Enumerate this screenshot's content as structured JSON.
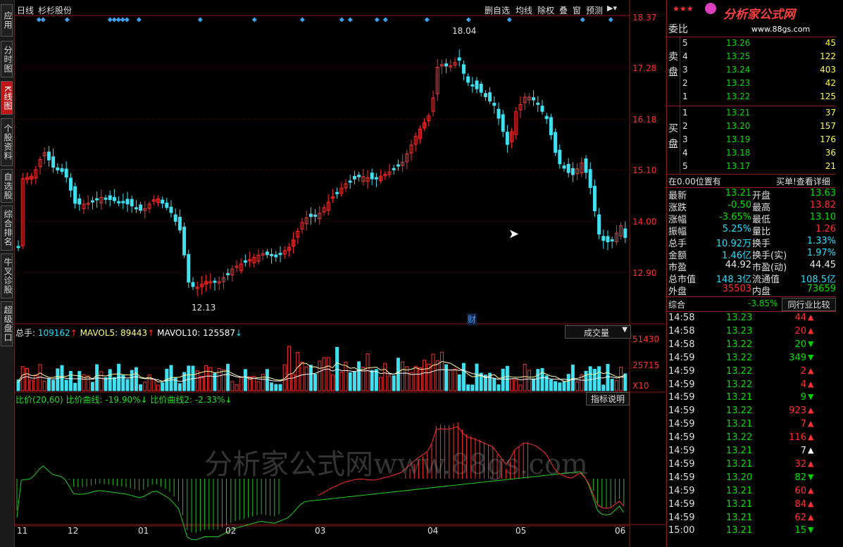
{
  "left_tabs": [
    "应用",
    "分时图",
    "K线图",
    "个股资料",
    "自选股",
    "综合排名",
    "牛叉诊股",
    "超级盘口"
  ],
  "header": {
    "period": "日线",
    "stock_name": "杉杉股份",
    "buttons": [
      "删自选",
      "均线",
      "除权",
      "叠",
      "窗",
      "预测"
    ],
    "logo_text": "分析家公式网",
    "logo_url": "www.88gs.com",
    "stars": "★★★"
  },
  "price_axis": [
    "18.37",
    "17.28",
    "16.18",
    "15.10",
    "14.00",
    "12.90"
  ],
  "annotations": {
    "high_label": "18.04",
    "low_label": "12.13",
    "cai_marker": "财"
  },
  "volume_panel": {
    "total_label": "总手:",
    "total_value": "109162",
    "mavol5_label": "MAVOL5:",
    "mavol5_value": "89443",
    "mavol10_label": "MAVOL10:",
    "mavol10_value": "125587",
    "dropdown": "成交量",
    "axis": [
      "51430",
      "25715",
      "X10"
    ]
  },
  "indicator_panel": {
    "title": "比价(20,60)",
    "line1_label": "比价曲线:",
    "line1_value": "-19.90%",
    "line2_label": "比价曲线2:",
    "line2_value": "-2.33%",
    "help_button": "指标说明",
    "watermark": "分析家公式网www.88gs.com"
  },
  "x_axis_months": [
    "11",
    "12",
    "01",
    "02",
    "03",
    "04",
    "05",
    "06"
  ],
  "order_book": {
    "header": "委比",
    "sell_label": "卖盘",
    "buy_label": "买盘",
    "sells": [
      {
        "level": "5",
        "price": "13.26",
        "vol": "45"
      },
      {
        "level": "4",
        "price": "13.25",
        "vol": "122"
      },
      {
        "level": "3",
        "price": "13.24",
        "vol": "403"
      },
      {
        "level": "2",
        "price": "13.23",
        "vol": "42"
      },
      {
        "level": "1",
        "price": "13.22",
        "vol": "125"
      }
    ],
    "buys": [
      {
        "level": "1",
        "price": "13.21",
        "vol": "37"
      },
      {
        "level": "2",
        "price": "13.20",
        "vol": "157"
      },
      {
        "level": "3",
        "price": "13.19",
        "vol": "176"
      },
      {
        "level": "4",
        "price": "13.18",
        "vol": "36"
      },
      {
        "level": "5",
        "price": "13.17",
        "vol": "21"
      }
    ]
  },
  "position_info": {
    "left": "在0.00位置有",
    "right": "买单!查看详细"
  },
  "quote": [
    {
      "l1": "最新",
      "v1": "13.21",
      "c1": "green",
      "l2": "开盘",
      "v2": "13.63",
      "c2": "green"
    },
    {
      "l1": "涨跌",
      "v1": "-0.50",
      "c1": "green",
      "l2": "最高",
      "v2": "13.82",
      "c2": "red"
    },
    {
      "l1": "涨幅",
      "v1": "-3.65%",
      "c1": "green",
      "l2": "最低",
      "v2": "13.10",
      "c2": "green"
    },
    {
      "l1": "振幅",
      "v1": "5.25%",
      "c1": "cyan",
      "l2": "量比",
      "v2": "1.26",
      "c2": "red"
    },
    {
      "l1": "总手",
      "v1": "10.92万",
      "c1": "cyan",
      "l2": "换手",
      "v2": "1.33%",
      "c2": "cyan"
    },
    {
      "l1": "金额",
      "v1": "1.46亿",
      "c1": "cyan",
      "l2": "换手(实)",
      "v2": "1.97%",
      "c2": "cyan"
    },
    {
      "l1": "市盈",
      "v1": "44.92",
      "c1": "white",
      "l2": "市盈(动)",
      "v2": "44.45",
      "c2": "white"
    },
    {
      "l1": "总市值",
      "v1": "148.3亿",
      "c1": "cyan",
      "l2": "流通值",
      "v2": "108.5亿",
      "c2": "cyan"
    },
    {
      "l1": "外盘",
      "v1": "35503",
      "c1": "red",
      "l2": "内盘",
      "v2": "73659",
      "c2": "green"
    }
  ],
  "sector": {
    "label": "综合",
    "value": "-3.85%",
    "button": "同行业比较"
  },
  "ticks": [
    {
      "time": "14:58",
      "price": "13.23",
      "vol": "44",
      "dir": "up"
    },
    {
      "time": "14:58",
      "price": "13.23",
      "vol": "20",
      "dir": "up"
    },
    {
      "time": "14:58",
      "price": "13.22",
      "vol": "20",
      "dir": "down"
    },
    {
      "time": "14:59",
      "price": "13.22",
      "vol": "349",
      "dir": "down"
    },
    {
      "time": "14:59",
      "price": "13.22",
      "vol": "2",
      "dir": "up"
    },
    {
      "time": "14:59",
      "price": "13.22",
      "vol": "4",
      "dir": "up"
    },
    {
      "time": "14:59",
      "price": "13.21",
      "vol": "9",
      "dir": "down"
    },
    {
      "time": "14:59",
      "price": "13.22",
      "vol": "923",
      "dir": "up"
    },
    {
      "time": "14:59",
      "price": "13.21",
      "vol": "7",
      "dir": "up"
    },
    {
      "time": "14:59",
      "price": "13.22",
      "vol": "116",
      "dir": "up"
    },
    {
      "time": "14:59",
      "price": "13.21",
      "vol": "7",
      "dir": "neutral"
    },
    {
      "time": "14:59",
      "price": "13.21",
      "vol": "32",
      "dir": "up"
    },
    {
      "time": "14:59",
      "price": "13.20",
      "vol": "82",
      "dir": "down"
    },
    {
      "time": "14:59",
      "price": "13.21",
      "vol": "60",
      "dir": "up"
    },
    {
      "time": "14:59",
      "price": "13.21",
      "vol": "84",
      "dir": "up"
    },
    {
      "time": "14:59",
      "price": "13.21",
      "vol": "62",
      "dir": "up"
    },
    {
      "time": "15:00",
      "price": "13.21",
      "vol": "15",
      "dir": "down"
    }
  ],
  "colors": {
    "up": "#ff3030",
    "down": "#40e0f0",
    "grid": "#8a1c1c",
    "axis_text": "#ff3030"
  }
}
